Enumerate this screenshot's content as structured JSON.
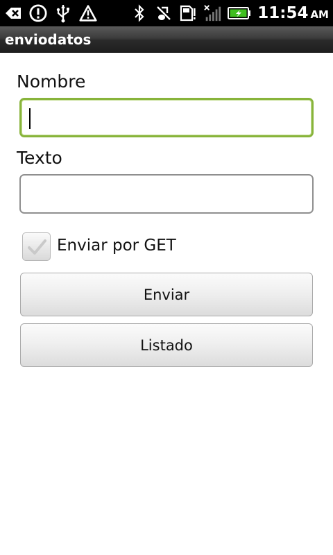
{
  "status_bar": {
    "time": "11:54",
    "ampm": "AM",
    "left_icons": [
      "back-arrow-icon",
      "alert-icon",
      "usb-icon",
      "warning-icon"
    ],
    "right_icons": [
      "bluetooth-icon",
      "vibrate-muted-icon",
      "sd-card-alert-icon",
      "signal-icon",
      "battery-charging-icon"
    ],
    "battery_color": "#3fbf1f"
  },
  "app": {
    "title": "enviodatos"
  },
  "form": {
    "nombre_label": "Nombre",
    "nombre_value": "",
    "texto_label": "Texto",
    "texto_value": "",
    "checkbox_label": "Enviar por GET",
    "checkbox_checked": false,
    "enviar_label": "Enviar",
    "listado_label": "Listado",
    "focus_color": "#88b43b"
  }
}
